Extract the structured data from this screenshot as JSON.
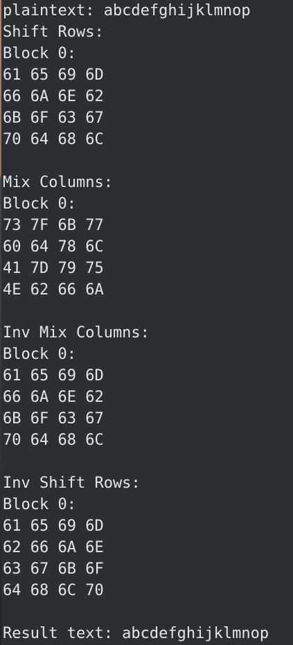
{
  "terminal": {
    "plaintext_line": "plaintext: abcdefghijklmnop",
    "sections": [
      {
        "title": "Shift Rows:",
        "block_label": "Block 0:",
        "rows": [
          "61 65 69 6D",
          "66 6A 6E 62",
          "6B 6F 63 67",
          "70 64 68 6C"
        ]
      },
      {
        "title": "Mix Columns:",
        "block_label": "Block 0:",
        "rows": [
          "73 7F 6B 77",
          "60 64 78 6C",
          "41 7D 79 75",
          "4E 62 66 6A"
        ]
      },
      {
        "title": "Inv Mix Columns:",
        "block_label": "Block 0:",
        "rows": [
          "61 65 69 6D",
          "66 6A 6E 62",
          "6B 6F 63 67",
          "70 64 68 6C"
        ]
      },
      {
        "title": "Inv Shift Rows:",
        "block_label": "Block 0:",
        "rows": [
          "61 65 69 6D",
          "62 66 6A 6E",
          "63 67 6B 6F",
          "64 68 6C 70"
        ]
      }
    ],
    "result_line": "Result text: abcdefghijklmnop"
  }
}
